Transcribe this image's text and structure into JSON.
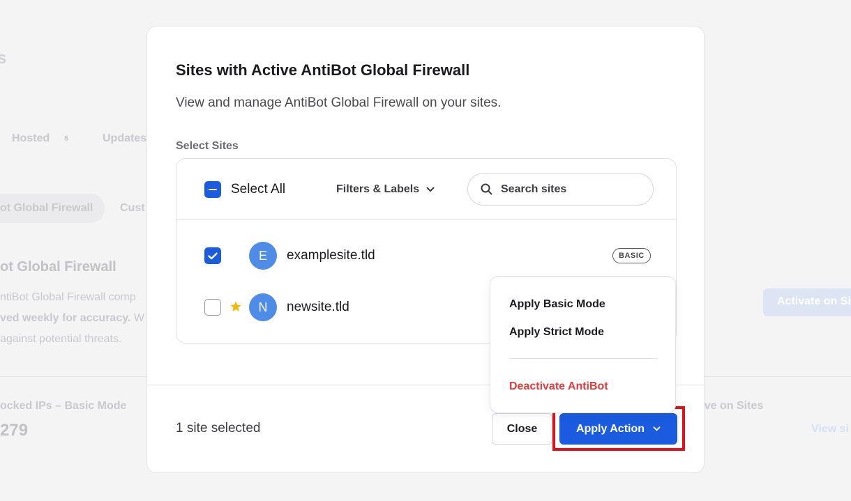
{
  "background": {
    "heading_fragment": "s",
    "tab_hosted": "Hosted",
    "tab_hosted_count": "6",
    "tab_updates": "Updates",
    "subtab_1": "ot Global Firewall",
    "subtab_2": "Cust",
    "section_title": "ot Global Firewall",
    "desc_line1": "ntiBot Global Firewall comp",
    "desc_line2_bold": "ved weekly for accuracy.",
    "desc_line2_rest": " W",
    "desc_line3": "against potential threats.",
    "activate_button": "Activate on Si",
    "blocked_label": "ocked IPs – Basic Mode",
    "blocked_count": "279",
    "active_label": "tive on Sites",
    "view_link": "View si"
  },
  "modal": {
    "title": "Sites with Active AntiBot Global Firewall",
    "subtitle": "View and manage AntiBot Global Firewall on your sites.",
    "select_sites_label": "Select Sites",
    "select_all": "Select All",
    "filters_label": "Filters & Labels",
    "search_placeholder": "Search sites",
    "sites": [
      {
        "initial": "E",
        "name": "examplesite.tld",
        "checked": true,
        "starred": false,
        "badge": "BASIC"
      },
      {
        "initial": "N",
        "name": "newsite.tld",
        "checked": false,
        "starred": true,
        "badge": ""
      }
    ],
    "selected_text": "1 site selected",
    "close_button": "Close",
    "apply_button": "Apply Action"
  },
  "menu": {
    "items": [
      {
        "label": "Apply Basic Mode"
      },
      {
        "label": "Apply Strict Mode"
      },
      {
        "label": "Deactivate AntiBot"
      }
    ]
  },
  "colors": {
    "accent": "#1a5be0",
    "avatar": "#4e8ce8",
    "danger": "#e33b3b",
    "highlight": "#e3101c",
    "star": "#f2b807"
  },
  "icons": [
    "check-icon",
    "minus-icon",
    "chevron-down-icon",
    "search-icon",
    "star-icon"
  ]
}
